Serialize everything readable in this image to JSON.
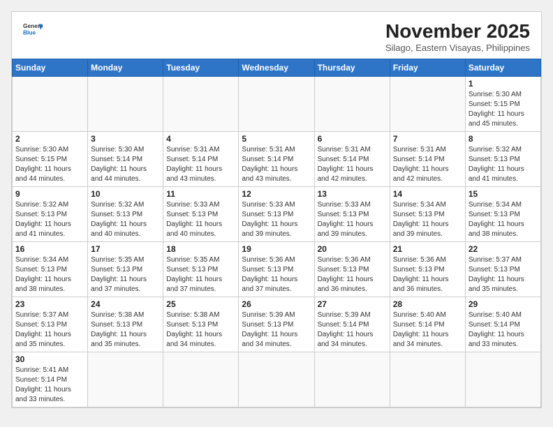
{
  "header": {
    "logo_line1": "General",
    "logo_line2": "Blue",
    "month_title": "November 2025",
    "subtitle": "Silago, Eastern Visayas, Philippines"
  },
  "days_of_week": [
    "Sunday",
    "Monday",
    "Tuesday",
    "Wednesday",
    "Thursday",
    "Friday",
    "Saturday"
  ],
  "weeks": [
    [
      {
        "day": "",
        "info": ""
      },
      {
        "day": "",
        "info": ""
      },
      {
        "day": "",
        "info": ""
      },
      {
        "day": "",
        "info": ""
      },
      {
        "day": "",
        "info": ""
      },
      {
        "day": "",
        "info": ""
      },
      {
        "day": "1",
        "info": "Sunrise: 5:30 AM\nSunset: 5:15 PM\nDaylight: 11 hours\nand 45 minutes."
      }
    ],
    [
      {
        "day": "2",
        "info": "Sunrise: 5:30 AM\nSunset: 5:15 PM\nDaylight: 11 hours\nand 44 minutes."
      },
      {
        "day": "3",
        "info": "Sunrise: 5:30 AM\nSunset: 5:14 PM\nDaylight: 11 hours\nand 44 minutes."
      },
      {
        "day": "4",
        "info": "Sunrise: 5:31 AM\nSunset: 5:14 PM\nDaylight: 11 hours\nand 43 minutes."
      },
      {
        "day": "5",
        "info": "Sunrise: 5:31 AM\nSunset: 5:14 PM\nDaylight: 11 hours\nand 43 minutes."
      },
      {
        "day": "6",
        "info": "Sunrise: 5:31 AM\nSunset: 5:14 PM\nDaylight: 11 hours\nand 42 minutes."
      },
      {
        "day": "7",
        "info": "Sunrise: 5:31 AM\nSunset: 5:14 PM\nDaylight: 11 hours\nand 42 minutes."
      },
      {
        "day": "8",
        "info": "Sunrise: 5:32 AM\nSunset: 5:13 PM\nDaylight: 11 hours\nand 41 minutes."
      }
    ],
    [
      {
        "day": "9",
        "info": "Sunrise: 5:32 AM\nSunset: 5:13 PM\nDaylight: 11 hours\nand 41 minutes."
      },
      {
        "day": "10",
        "info": "Sunrise: 5:32 AM\nSunset: 5:13 PM\nDaylight: 11 hours\nand 40 minutes."
      },
      {
        "day": "11",
        "info": "Sunrise: 5:33 AM\nSunset: 5:13 PM\nDaylight: 11 hours\nand 40 minutes."
      },
      {
        "day": "12",
        "info": "Sunrise: 5:33 AM\nSunset: 5:13 PM\nDaylight: 11 hours\nand 39 minutes."
      },
      {
        "day": "13",
        "info": "Sunrise: 5:33 AM\nSunset: 5:13 PM\nDaylight: 11 hours\nand 39 minutes."
      },
      {
        "day": "14",
        "info": "Sunrise: 5:34 AM\nSunset: 5:13 PM\nDaylight: 11 hours\nand 39 minutes."
      },
      {
        "day": "15",
        "info": "Sunrise: 5:34 AM\nSunset: 5:13 PM\nDaylight: 11 hours\nand 38 minutes."
      }
    ],
    [
      {
        "day": "16",
        "info": "Sunrise: 5:34 AM\nSunset: 5:13 PM\nDaylight: 11 hours\nand 38 minutes."
      },
      {
        "day": "17",
        "info": "Sunrise: 5:35 AM\nSunset: 5:13 PM\nDaylight: 11 hours\nand 37 minutes."
      },
      {
        "day": "18",
        "info": "Sunrise: 5:35 AM\nSunset: 5:13 PM\nDaylight: 11 hours\nand 37 minutes."
      },
      {
        "day": "19",
        "info": "Sunrise: 5:36 AM\nSunset: 5:13 PM\nDaylight: 11 hours\nand 37 minutes."
      },
      {
        "day": "20",
        "info": "Sunrise: 5:36 AM\nSunset: 5:13 PM\nDaylight: 11 hours\nand 36 minutes."
      },
      {
        "day": "21",
        "info": "Sunrise: 5:36 AM\nSunset: 5:13 PM\nDaylight: 11 hours\nand 36 minutes."
      },
      {
        "day": "22",
        "info": "Sunrise: 5:37 AM\nSunset: 5:13 PM\nDaylight: 11 hours\nand 35 minutes."
      }
    ],
    [
      {
        "day": "23",
        "info": "Sunrise: 5:37 AM\nSunset: 5:13 PM\nDaylight: 11 hours\nand 35 minutes."
      },
      {
        "day": "24",
        "info": "Sunrise: 5:38 AM\nSunset: 5:13 PM\nDaylight: 11 hours\nand 35 minutes."
      },
      {
        "day": "25",
        "info": "Sunrise: 5:38 AM\nSunset: 5:13 PM\nDaylight: 11 hours\nand 34 minutes."
      },
      {
        "day": "26",
        "info": "Sunrise: 5:39 AM\nSunset: 5:13 PM\nDaylight: 11 hours\nand 34 minutes."
      },
      {
        "day": "27",
        "info": "Sunrise: 5:39 AM\nSunset: 5:14 PM\nDaylight: 11 hours\nand 34 minutes."
      },
      {
        "day": "28",
        "info": "Sunrise: 5:40 AM\nSunset: 5:14 PM\nDaylight: 11 hours\nand 34 minutes."
      },
      {
        "day": "29",
        "info": "Sunrise: 5:40 AM\nSunset: 5:14 PM\nDaylight: 11 hours\nand 33 minutes."
      }
    ],
    [
      {
        "day": "30",
        "info": "Sunrise: 5:41 AM\nSunset: 5:14 PM\nDaylight: 11 hours\nand 33 minutes."
      },
      {
        "day": "",
        "info": ""
      },
      {
        "day": "",
        "info": ""
      },
      {
        "day": "",
        "info": ""
      },
      {
        "day": "",
        "info": ""
      },
      {
        "day": "",
        "info": ""
      },
      {
        "day": "",
        "info": ""
      }
    ]
  ]
}
